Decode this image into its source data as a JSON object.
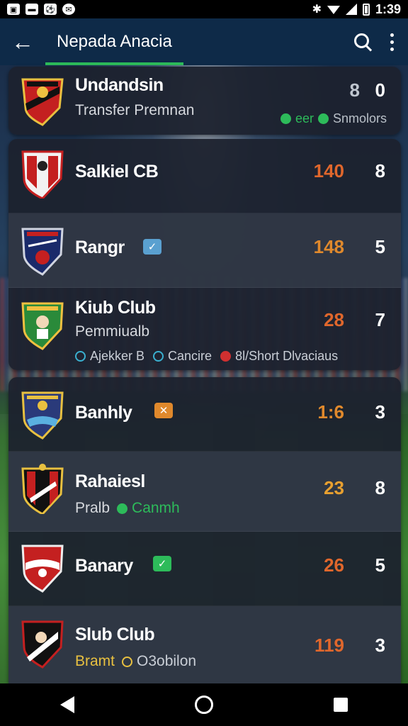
{
  "status_bar": {
    "time": "1:39"
  },
  "app_bar": {
    "title": "Nepada Anacia"
  },
  "colors": {
    "accent": "#2dbb5a",
    "app_bar": "#0e2a48",
    "score_orange": "#e0672c"
  },
  "teams": [
    {
      "name": "Undandsin",
      "subtitle": "Transfer Premnan",
      "score_a": "8",
      "score_b": "0",
      "tag_text": "Snmolors",
      "tag_prefix": "eer"
    },
    {
      "name": "Salkiel CB",
      "score_a": "140",
      "score_b": "8"
    },
    {
      "name": "Rangr",
      "score_a": "148",
      "score_b": "5",
      "badge_icon": "check-icon"
    },
    {
      "name": "Kiub Club",
      "subtitle": "Pemmiualb",
      "score_a": "28",
      "score_b": "7",
      "tags": [
        "Ajekker B",
        "Cancire",
        "8l/Short Dlvaciaus"
      ]
    },
    {
      "name": "Banhly",
      "score_a": "1:6",
      "score_b": "3",
      "badge_icon": "cross-icon"
    },
    {
      "name": "Rahaiesl",
      "subtitle": "Pralb",
      "subtitle_tag": "Canmh",
      "score_a": "23",
      "score_b": "8"
    },
    {
      "name": "Banary",
      "score_a": "26",
      "score_b": "5",
      "badge_icon": "check-icon"
    },
    {
      "name": "Slub Club",
      "subtitle": "Bramt",
      "subtitle_tag": "O3obilon",
      "score_a": "119",
      "score_b": "3"
    }
  ]
}
